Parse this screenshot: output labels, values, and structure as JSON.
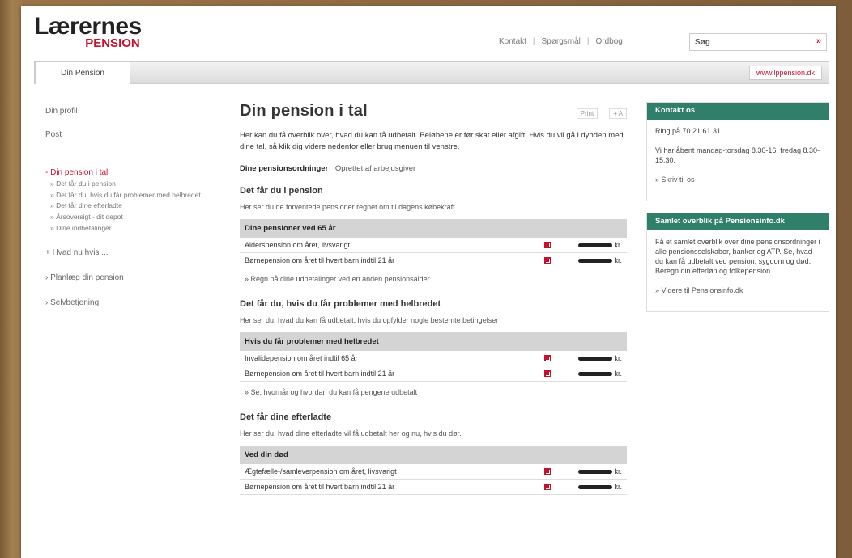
{
  "logo": {
    "line1": "Lærernes",
    "line2": "PENSION"
  },
  "top_links": [
    "Kontakt",
    "Spørgsmål",
    "Ordbog"
  ],
  "search": {
    "label": "Søg",
    "go": "»"
  },
  "nav": {
    "tab": "Din Pension",
    "url_button": "www.lppension.dk"
  },
  "sidebar": {
    "items": [
      "Din profil",
      "Post"
    ],
    "active": "- Din pension i tal",
    "sub": [
      "» Det får du i pension",
      "» Det får du, hvis du får problemer med helbredet",
      "» Det får dine efterladte",
      "» Årsoversigt - dit depot",
      "» Dine indbetalinger"
    ],
    "sections": [
      "+ Hvad nu hvis ...",
      "› Planlæg din pension",
      "› Selvbetjening"
    ]
  },
  "main": {
    "title": "Din pension i tal",
    "tools": [
      "Print",
      "+ A"
    ],
    "intro": "Her kan du få overblik over, hvad du kan få udbetalt. Beløbene er før skat eller afgift. Hvis du vil gå i dybden med dine tal, så klik dig videre nedenfor eller brug menuen til venstre.",
    "ordninger": {
      "label": "Dine pensionsordninger",
      "sub": "Oprettet af arbejdsgiver"
    },
    "sections": [
      {
        "heading": "Det får du i pension",
        "desc": "Her ser du de forventede pensioner regnet om til dagens købekraft.",
        "table_header": "Dine pensioner ved 65 år",
        "rows": [
          {
            "label": "Alderspension om året, livsvarigt",
            "unit": "kr."
          },
          {
            "label": "Børnepension om året til hvert barn indtil 21 år",
            "unit": "kr."
          }
        ],
        "more": "» Regn på dine udbetalinger ved en anden pensionsalder"
      },
      {
        "heading": "Det får du, hvis du får problemer med helbredet",
        "desc": "Her ser du, hvad du kan få udbetalt, hvis du opfylder nogle bestemte betingelser",
        "table_header": "Hvis du får problemer med helbredet",
        "rows": [
          {
            "label": "Invalidepension om året indtil 65 år",
            "unit": "kr."
          },
          {
            "label": "Børnepension om året til hvert barn indtil 21 år",
            "unit": "kr."
          }
        ],
        "more": "» Se, hvornår og hvordan du kan få pengene udbetalt"
      },
      {
        "heading": "Det får dine efterladte",
        "desc": "Her ser du, hvad dine efterladte vil få udbetalt her og nu, hvis du dør.",
        "table_header": "Ved din død",
        "rows": [
          {
            "label": "Ægtefælle-/samleverpension om året, livsvarigt",
            "unit": "kr."
          },
          {
            "label": "Børnepension om året til hvert barn indtil 21 år",
            "unit": "kr."
          }
        ],
        "more": ""
      }
    ]
  },
  "contact": {
    "header": "Kontakt os",
    "phone": "Ring på 70 21 61 31",
    "hours": "Vi har åbent mandag-torsdag 8.30-16, fredag 8.30-15.30.",
    "write": "» Skriv til os"
  },
  "overview": {
    "header": "Samlet overblik på Pensionsinfo.dk",
    "text": "Få et samlet overblik over dine pensionsordninger i alle pensionsselskaber, banker og ATP. Se, hvad du kan få udbetalt ved pension, sygdom og død. Beregn din efterløn og folkepension.",
    "link": "» Videre til Pensionsinfo.dk"
  }
}
